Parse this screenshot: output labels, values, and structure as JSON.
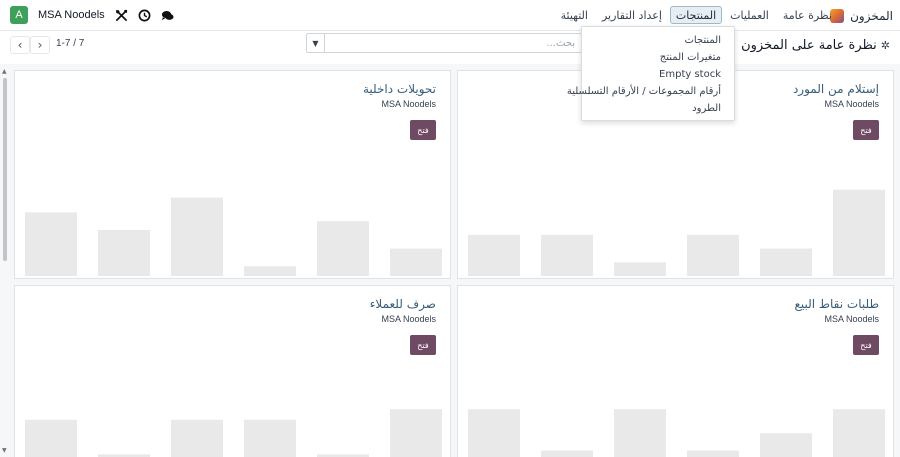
{
  "navbar": {
    "app_title": "المخزون",
    "menu": [
      {
        "label": "نظرة عامة",
        "active": false
      },
      {
        "label": "العمليات",
        "active": false
      },
      {
        "label": "المنتجات",
        "active": true
      },
      {
        "label": "إعداد التقارير",
        "active": false
      },
      {
        "label": "التهيئة",
        "active": false
      }
    ],
    "company": "MSA Noodels",
    "avatar_letter": "A",
    "icons": [
      "chat-icon",
      "clock-icon",
      "tools-icon"
    ]
  },
  "control_panel": {
    "title": "نظرة عامة على المخزون",
    "search_placeholder": "بحث...",
    "pager_value": "1-7 / 7"
  },
  "products_dropdown": {
    "items": [
      "المنتجات",
      "متغيرات المنتج",
      "Empty stock",
      "أرقام المجموعات / الأرقام التسلسلية",
      "الطرود"
    ]
  },
  "cards": [
    {
      "title": "إستلام من المورد",
      "company": "MSA Noodels",
      "button": "فتح",
      "bars": [
        0.42,
        0.42,
        0.14,
        0.42,
        0.28,
        0.88
      ]
    },
    {
      "title": "تحويلات داخلية",
      "company": "MSA Noodels",
      "button": "فتح",
      "bars": [
        0.65,
        0.47,
        0.8,
        0.1,
        0.56,
        0.28
      ]
    },
    {
      "title": "طلبات نقاط البيع",
      "company": "MSA Noodels",
      "button": "فتح",
      "bars": [
        0.55,
        0.12,
        0.55,
        0.12,
        0.3,
        0.55
      ]
    },
    {
      "title": "صرف للعملاء",
      "company": "MSA Noodels",
      "button": "فتح",
      "bars": [
        0.44,
        0.08,
        0.44,
        0.44,
        0.08,
        0.55
      ]
    }
  ],
  "colors": {
    "accent": "#6e4a63",
    "title": "#375d7a",
    "bar": "#e9e9e9"
  }
}
